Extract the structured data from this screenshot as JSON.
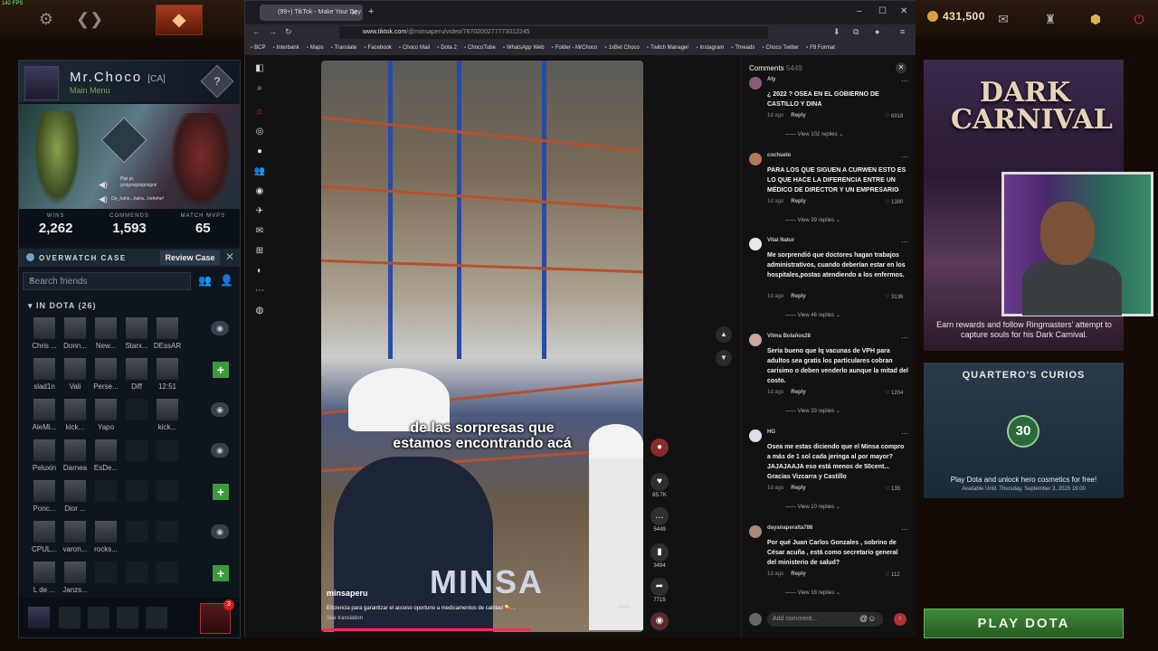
{
  "dota": {
    "fps": "142 FPS",
    "gold": "431,500",
    "profile": {
      "name": "Mr.Choco",
      "tag": "[CA]",
      "status": "Main Menu",
      "rank_icon": "?"
    },
    "stream_overlay": {
      "line1": "Pipi pi,",
      "line2": "grsigrsigrsigrsigrsi",
      "line3": "Oe_hahe...haha...hehehe!"
    },
    "stats": [
      {
        "label": "WINS",
        "value": "2,262"
      },
      {
        "label": "COMMENDS",
        "value": "1,593"
      },
      {
        "label": "MATCH MVPS",
        "value": "65"
      }
    ],
    "overwatch": {
      "title": "OVERWATCH CASE",
      "button": "Review Case"
    },
    "search_placeholder": "Search friends",
    "in_dota": "IN DOTA (26)",
    "friends": [
      [
        "Chris ...",
        "Donn...",
        "New...",
        "Starx...",
        "DEssAR"
      ],
      [
        "slad1n",
        "Vali",
        "Perse...",
        "Diff",
        "12:51"
      ],
      [
        "AleMi...",
        "kick...",
        "Yapo",
        "",
        "kick..."
      ],
      [
        "Peluxin",
        "Darnea",
        "EsDe...",
        "",
        ""
      ],
      [
        "Ponc...",
        "Dior ...",
        "",
        "",
        ""
      ],
      [
        "CPUL...",
        "varon...",
        "rocks...",
        "",
        ""
      ],
      [
        "L de ...",
        "Janzs...",
        "",
        "",
        ""
      ]
    ],
    "notification_count": "3",
    "carnival": {
      "logo_line1": "DARK",
      "logo_line2": "CARNIVAL",
      "desc": "Earn rewards and follow Ringmasters' attempt to capture souls for his Dark Carnival."
    },
    "curios": {
      "title": "QUARTERO'S CURIOS",
      "number": "30",
      "line1": "Play Dota and unlock hero cosmetics for free!",
      "line2": "Available Until:  Thursday, September 3, 2026 18:00"
    },
    "play_button": "PLAY DOTA"
  },
  "browser": {
    "tab_title": "(99+) TikTok - Make Your Day",
    "url_host": "www.tiktok.com",
    "url_path": "/@minsaperu/video/7670200277773012245",
    "bookmarks": [
      "BCP",
      "Interbank",
      "Maps",
      "Translate",
      "Facebook",
      "Choco Mail",
      "Dota 2",
      "ChocoTube",
      "WhatsApp Web",
      "Folder - MrChoco",
      "1xBet Choco",
      "Twitch Manager",
      "Instagram",
      "Threads",
      "Choco Twitter",
      "F8 Format"
    ]
  },
  "tiktok": {
    "caption_line1": "de las sorpresas que",
    "caption_line2": "estamos encontrando acá",
    "jacket_text": "MINSA",
    "username": "minsaperu",
    "description": "Eficiencia para garantizar el acceso oportuno a medicamentos de calidad 💊...",
    "more": "more",
    "translation": "See translation",
    "actions": [
      {
        "icon": "heart-icon",
        "count": "85.7K"
      },
      {
        "icon": "comment-icon",
        "count": "5449"
      },
      {
        "icon": "bookmark-icon",
        "count": "3494"
      },
      {
        "icon": "share-icon",
        "count": "7715"
      }
    ],
    "comments_title": "Comments",
    "comments_count": "5449",
    "comments": [
      {
        "user": "Aly",
        "text": "¿ 2022 ? OSEA EN EL GOBIERNO DE CASTILLO Y DINA",
        "time": "1d ago",
        "reply": "Reply",
        "likes": "6918",
        "replies": "View 102 replies"
      },
      {
        "user": "cochuelo",
        "text": "PARA LOS QUE SIGUEN A CURWEN ESTO ES LO QUE HACE LA DIFERENCIA ENTRE UN MÉDICO DE DIRECTOR Y UN EMPRESARIO",
        "time": "1d ago",
        "reply": "Reply",
        "likes": "1380",
        "replies": "View 39 replies"
      },
      {
        "user": "Vital Natur",
        "text": "Me sorprendió que doctores hagan trabajos administrativos, cuando deberían estar en los hospitales,postas atendiendo a los enfermos.",
        "time": "1d ago",
        "reply": "Reply",
        "likes": "3136",
        "replies": "View 46 replies"
      },
      {
        "user": "Vilma Bolaños28",
        "text": "Sería bueno que lq vacunas de VPH para adultos sea gratis los particulares cobran carisimo o deben venderlo aunque la mitad del costo.",
        "time": "1d ago",
        "reply": "Reply",
        "likes": "1204",
        "replies": "View 33 replies"
      },
      {
        "user": "HG",
        "text": "Osea me estas diciendo que el Minsa compro a más de 1 sol cada jeringa al por mayor? JAJAJAAJA eso está menos de 50cent... Gracias Vizcarra y Castillo",
        "time": "1d ago",
        "reply": "Reply",
        "likes": "135",
        "replies": "View 10 replies"
      },
      {
        "user": "dayanaperalta786",
        "text": "Por qué Juan Carlos Gonzales , sobrino de César acuña , está como secretario general del ministerio de salud?",
        "time": "1d ago",
        "reply": "Reply",
        "likes": "112",
        "replies": "View 18 replies"
      }
    ],
    "add_comment_placeholder": "Add comment..."
  }
}
